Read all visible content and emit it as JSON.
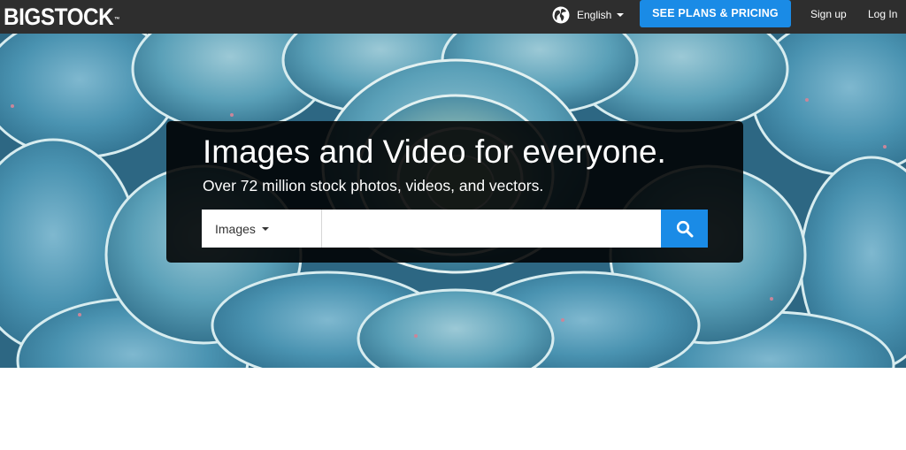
{
  "header": {
    "logo_text": "BIGSTOCK",
    "logo_tm": "™",
    "language": {
      "label": "English",
      "icon": "globe-icon"
    },
    "plans_button": "SEE PLANS & PRICING",
    "signup": "Sign up",
    "login": "Log In"
  },
  "hero": {
    "headline": "Images and Video for everyone.",
    "subhead": "Over 72 million stock photos, videos, and vectors.",
    "search": {
      "type_selected": "Images",
      "placeholder": "",
      "value": "",
      "button_icon": "search-icon"
    }
  },
  "colors": {
    "header_bg": "#2e2e2e",
    "accent": "#1a8be6",
    "panel_bg": "rgba(0,0,0,0.88)"
  }
}
